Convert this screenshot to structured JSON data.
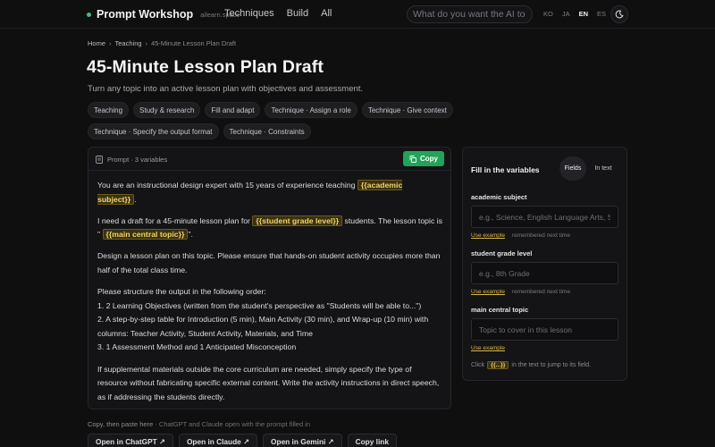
{
  "brand": {
    "name": "Prompt Workshop",
    "domain": "ailearn.space"
  },
  "nav": {
    "items": [
      "Techniques",
      "Build",
      "All"
    ]
  },
  "search": {
    "placeholder": "What do you want the AI to do?"
  },
  "langs": [
    "KO",
    "JA",
    "EN",
    "ES"
  ],
  "active_lang": "EN",
  "breadcrumb": {
    "home": "Home",
    "section": "Teaching",
    "current": "45-Minute Lesson Plan Draft",
    "sep": "›"
  },
  "page": {
    "title": "45-Minute Lesson Plan Draft",
    "subtitle": "Turn any topic into an active lesson plan with objectives and assessment."
  },
  "tags": [
    "Teaching",
    "Study & research",
    "Fill and adapt",
    "Technique · Assign a role",
    "Technique · Give context",
    "Technique · Specify the output format",
    "Technique · Constraints"
  ],
  "prompt_card": {
    "header": "Prompt · 3 variables",
    "copy_label": "Copy",
    "p1_a": "You are an instructional design expert with 15 years of experience teaching",
    "var_subject": "{{academic subject}}",
    "p1_b": ".",
    "p2_a": "I need a draft for a 45-minute lesson plan for",
    "var_grade": "{{student grade level}}",
    "p2_b": "students. The lesson topic is \"",
    "var_topic": "{{main central topic}}",
    "p2_c": "\".",
    "p3": "Design a lesson plan on this topic. Please ensure that hands-on student activity occupies more than half of the total class time.",
    "p4_l1": "Please structure the output in the following order:",
    "p4_l2": "1. 2 Learning Objectives (written from the student's perspective as \"Students will be able to...\")",
    "p4_l3": "2. A step-by-step table for Introduction (5 min), Main Activity (30 min), and Wrap-up (10 min) with columns: Teacher Activity, Student Activity, Materials, and Time",
    "p4_l4": "3. 1 Assessment Method and 1 Anticipated Misconception",
    "p5": "If supplemental materials outside the core curriculum are needed, simply specify the type of resource without fabricating specific external content. Write the activity instructions in direct speech, as if addressing the students directly."
  },
  "fill_panel": {
    "title": "Fill in the variables",
    "toggle_fields": "Fields",
    "toggle_in_text": "In text",
    "fields": [
      {
        "label": "academic subject",
        "placeholder": "e.g., Science, English Language Arts, S",
        "example": "Use example",
        "remembered": "remembered next time"
      },
      {
        "label": "student grade level",
        "placeholder": "e.g., 8th Grade",
        "example": "Use example",
        "remembered": "remembered next time"
      },
      {
        "label": "main central topic",
        "placeholder": "Topic to cover in this lesson",
        "example": "Use example"
      }
    ],
    "help_a": "Click",
    "help_chip": "{{...}}",
    "help_b": "in the text to jump to its field."
  },
  "footer": {
    "note_a": "Copy, then paste here",
    "note_b": " · ChatGPT and Claude open with the prompt filled in",
    "actions": [
      "Open in ChatGPT ↗",
      "Open in Claude ↗",
      "Open in Gemini ↗",
      "Copy link"
    ]
  },
  "colors": {
    "accent_green": "#22a35a",
    "variable_highlight": "#f3d36b",
    "background": "#0f0f10"
  },
  "icons": [
    "brand-dot-icon",
    "theme-toggle-icon",
    "document-icon",
    "copy-icon"
  ]
}
